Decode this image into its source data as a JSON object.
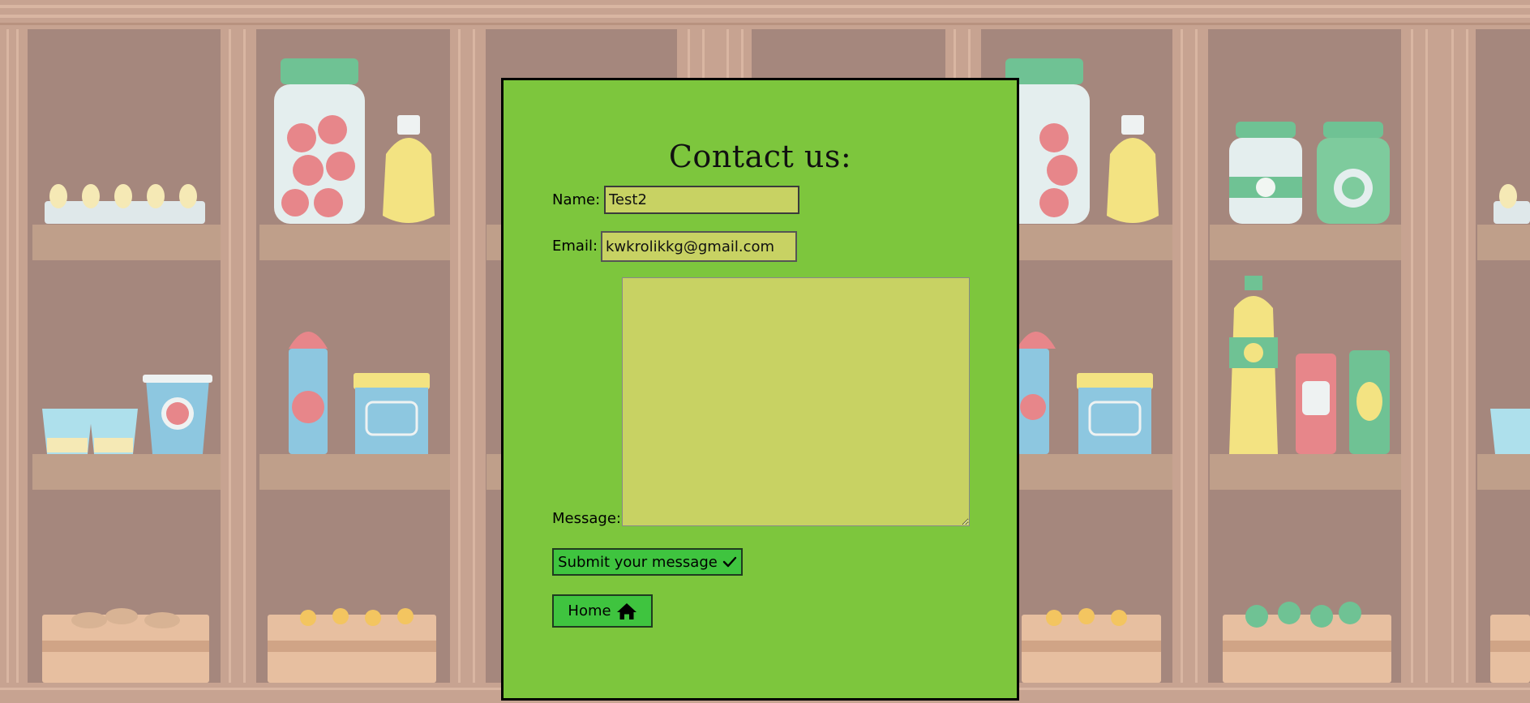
{
  "page": {
    "background_color": "#a5877d",
    "panel_color": "#7dc63d",
    "field_color": "#c8d263",
    "button_color": "#3fc43f"
  },
  "form": {
    "title": "Contact us:",
    "name_label": "Name:",
    "name_value": "Test2",
    "email_label": "Email:",
    "email_value": "kwkrolikkg@gmail.com",
    "message_label": "Message:",
    "message_value": "",
    "submit_label": "Submit your message",
    "submit_icon": "checkmark-icon",
    "home_label": "Home",
    "home_icon": "home-icon"
  }
}
